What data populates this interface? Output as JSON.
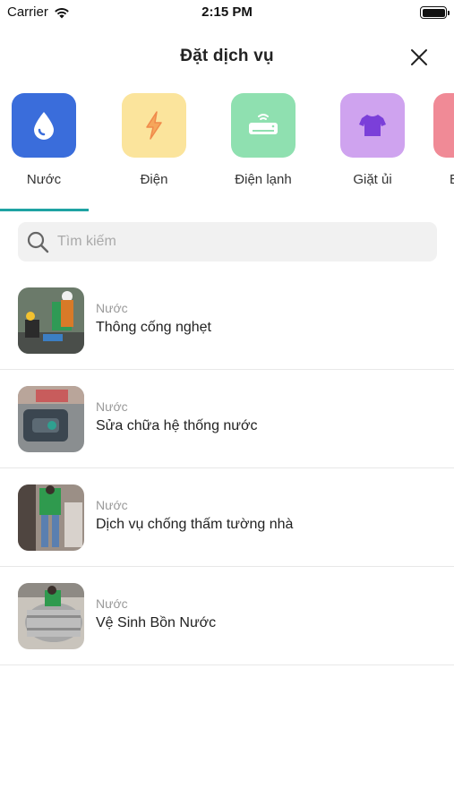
{
  "status_bar": {
    "carrier": "Carrier",
    "time": "2:15 PM"
  },
  "header": {
    "title": "Đặt dịch vụ"
  },
  "categories": [
    {
      "label": "Nước",
      "icon": "water-drop-icon",
      "bg": "#3a6ddb"
    },
    {
      "label": "Điện",
      "icon": "lightning-icon",
      "bg": "#fbe49c"
    },
    {
      "label": "Điện lạnh",
      "icon": "air-conditioner-icon",
      "bg": "#8fe0b0"
    },
    {
      "label": "Giặt ủi",
      "icon": "shirt-icon",
      "bg": "#cfa3ef"
    }
  ],
  "active_tab_color": "#1fa3a3",
  "search": {
    "placeholder": "Tìm kiếm"
  },
  "services": [
    {
      "category": "Nước",
      "name": "Thông cống nghẹt"
    },
    {
      "category": "Nước",
      "name": "Sửa chữa hệ thống nước"
    },
    {
      "category": "Nước",
      "name": "Dịch vụ chống thấm tường nhà"
    },
    {
      "category": "Nước",
      "name": "Vệ Sinh Bồn Nước"
    }
  ]
}
